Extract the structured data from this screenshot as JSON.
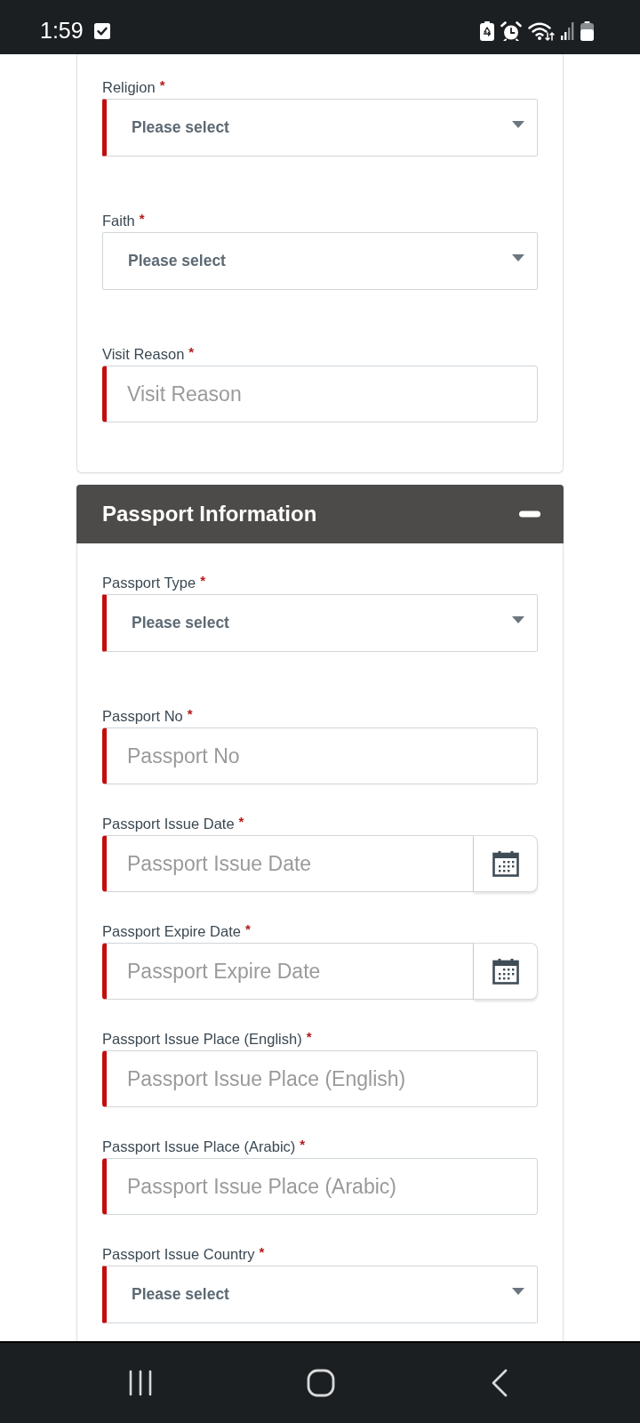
{
  "status_bar": {
    "time": "1:59"
  },
  "sections": [
    {
      "kind": "card",
      "fields": [
        {
          "kind": "select",
          "label": "Religion",
          "required_mark": "*",
          "placeholder": "Please select",
          "invalid": true
        },
        {
          "kind": "select",
          "label": "Faith",
          "required_mark": "*",
          "placeholder": "Please select",
          "invalid": false
        },
        {
          "kind": "text",
          "label": "Visit Reason",
          "required_mark": "*",
          "placeholder": "Visit Reason",
          "invalid": true
        }
      ]
    },
    {
      "kind": "panel",
      "title": "Passport Information",
      "expanded": true,
      "fields": [
        {
          "kind": "select",
          "label": "Passport Type",
          "required_mark": "*",
          "placeholder": "Please select",
          "invalid": true
        },
        {
          "kind": "text",
          "label": "Passport No",
          "required_mark": "*",
          "placeholder": "Passport No",
          "invalid": true
        },
        {
          "kind": "date",
          "label": "Passport Issue Date",
          "required_mark": "*",
          "placeholder": "Passport Issue Date",
          "invalid": true
        },
        {
          "kind": "date",
          "label": "Passport Expire Date",
          "required_mark": "*",
          "placeholder": "Passport Expire Date",
          "invalid": true
        },
        {
          "kind": "text",
          "label": "Passport Issue Place (English)",
          "required_mark": "*",
          "placeholder": "Passport Issue Place (English)",
          "invalid": true
        },
        {
          "kind": "text",
          "label": "Passport Issue Place (Arabic)",
          "required_mark": "*",
          "placeholder": "Passport Issue Place (Arabic)",
          "invalid": true
        },
        {
          "kind": "select",
          "label": "Passport Issue Country",
          "required_mark": "*",
          "placeholder": "Please select",
          "invalid": true
        }
      ]
    }
  ]
}
